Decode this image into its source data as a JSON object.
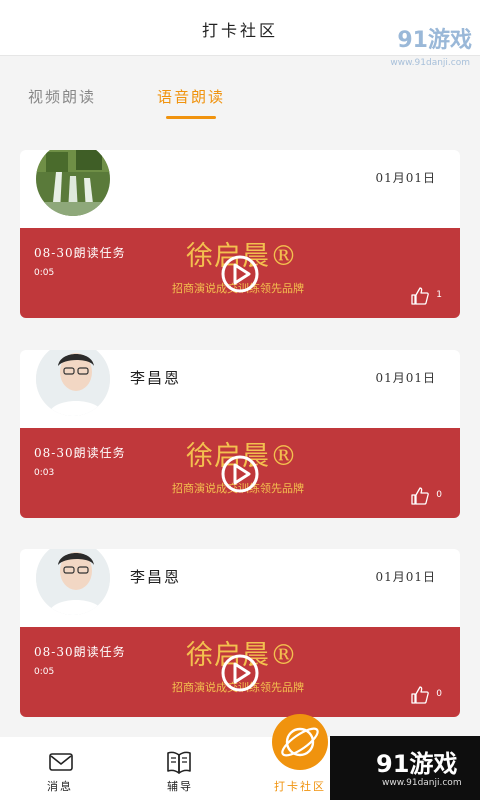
{
  "header": {
    "title": "打卡社区"
  },
  "watermark": {
    "logo": "91游戏",
    "site": "www.91danji.com"
  },
  "tabs": [
    {
      "label": "视频朗读",
      "active": false
    },
    {
      "label": "语音朗读",
      "active": true
    }
  ],
  "posts": [
    {
      "author": "",
      "date": "01月01日",
      "task": "08-30朗读任务",
      "duration": "0:05",
      "likes": "1",
      "brand": "徐启晨®",
      "slogan": "招商演说成交训练领先品牌",
      "avatar": "waterfall-photo"
    },
    {
      "author": "李昌恩",
      "date": "01月01日",
      "task": "08-30朗读任务",
      "duration": "0:03",
      "likes": "0",
      "brand": "徐启晨®",
      "slogan": "招商演说成交训练领先品牌",
      "avatar": "person-photo"
    },
    {
      "author": "李昌恩",
      "date": "01月01日",
      "task": "08-30朗读任务",
      "duration": "0:05",
      "likes": "0",
      "brand": "徐启晨®",
      "slogan": "招商演说成交训练领先品牌",
      "avatar": "person-photo"
    }
  ],
  "nav": [
    {
      "label": "消息",
      "icon": "envelope-icon",
      "active": false
    },
    {
      "label": "辅导",
      "icon": "book-icon",
      "active": false
    },
    {
      "label": "打卡社区",
      "icon": "planet-icon",
      "active": true
    }
  ],
  "colors": {
    "accent": "#f0930e",
    "media_bg": "#c0383b",
    "brand_text": "#f3c04f"
  }
}
